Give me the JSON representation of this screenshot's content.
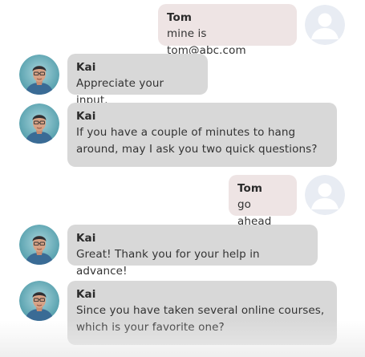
{
  "messages": [
    {
      "sender": "Tom",
      "text": "mine is tom@abc.com",
      "role": "user",
      "avatar_icon": "user-placeholder-icon"
    },
    {
      "sender": "Kai",
      "text": "Appreciate your input.",
      "role": "bot",
      "avatar_icon": "bot-avatar-icon"
    },
    {
      "sender": "Kai",
      "text": "If you have a couple of minutes to hang\naround, may I ask you two quick questions?",
      "role": "bot",
      "avatar_icon": "bot-avatar-icon"
    },
    {
      "sender": "Tom",
      "text": "go ahead",
      "role": "user",
      "avatar_icon": "user-placeholder-icon"
    },
    {
      "sender": "Kai",
      "text": "Great! Thank you for your help in advance!",
      "role": "bot",
      "avatar_icon": "bot-avatar-icon"
    },
    {
      "sender": "Kai",
      "text": "Since you have taken several online courses,\nwhich is your favorite one?",
      "role": "bot",
      "avatar_icon": "bot-avatar-icon"
    }
  ],
  "colors": {
    "bot_bubble": "#d8d8d8",
    "user_bubble": "#eee4e4",
    "user_avatar_bg": "#e8ecf3"
  }
}
